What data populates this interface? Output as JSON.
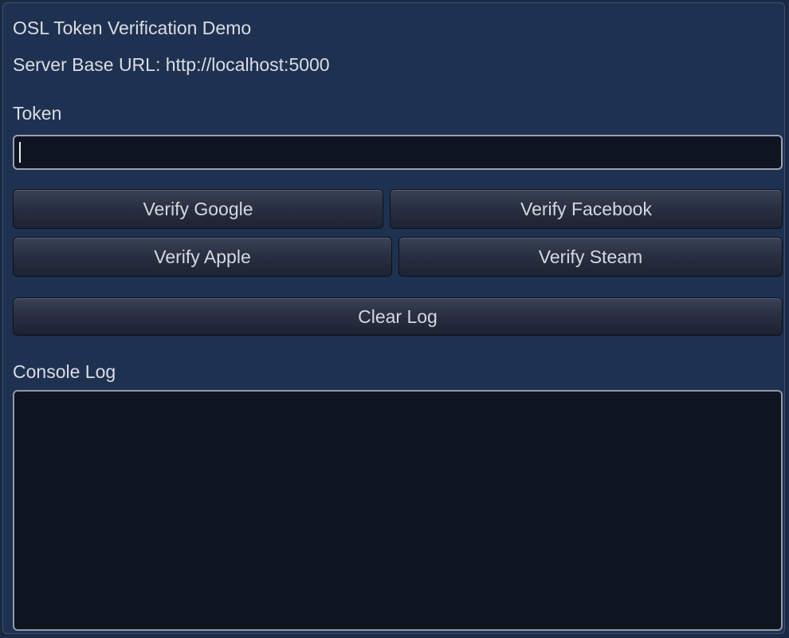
{
  "window": {
    "title": "OSL Token Verification Demo",
    "server_url_text": "Server Base URL: http://localhost:5000"
  },
  "token": {
    "label": "Token",
    "value": "",
    "placeholder": ""
  },
  "buttons": {
    "verify_google": "Verify Google",
    "verify_facebook": "Verify Facebook",
    "verify_apple": "Verify Apple",
    "verify_steam": "Verify Steam",
    "clear_log": "Clear Log"
  },
  "console": {
    "label": "Console Log",
    "content": ""
  },
  "colors": {
    "background": "#1f3150",
    "field_background": "#0e1420",
    "text": "#d9dde4"
  }
}
